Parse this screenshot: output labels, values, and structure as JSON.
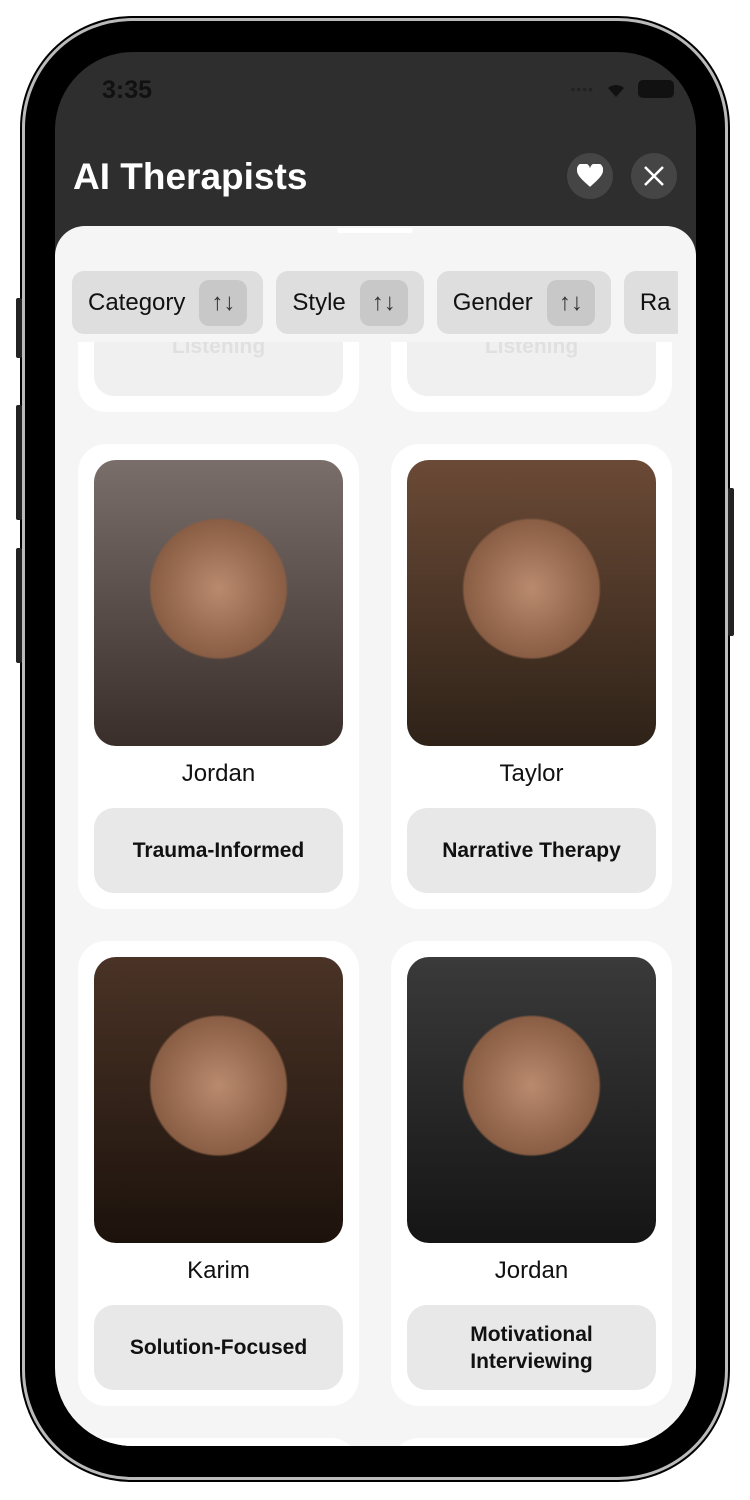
{
  "status_bar": {
    "time": "3:35"
  },
  "header": {
    "title": "AI Therapists",
    "favorites_icon": "heart-icon",
    "close_icon": "close-icon"
  },
  "filters": [
    {
      "label": "Category"
    },
    {
      "label": "Style"
    },
    {
      "label": "Gender"
    },
    {
      "label": "Ra"
    }
  ],
  "faded_row": {
    "left_tag": "Listening",
    "right_tag": "Listening"
  },
  "therapists": [
    {
      "name": "Jordan",
      "specialty": "Trauma-Informed",
      "photo_colors": [
        "#7a6e6a",
        "#3a2e2a"
      ]
    },
    {
      "name": "Taylor",
      "specialty": "Narrative Therapy",
      "photo_colors": [
        "#6b4a36",
        "#2e2218"
      ]
    },
    {
      "name": "Karim",
      "specialty": "Solution-Focused",
      "photo_colors": [
        "#4a3326",
        "#1c120c"
      ]
    },
    {
      "name": "Jordan",
      "specialty": "Motivational Interviewing",
      "photo_colors": [
        "#3a3a3a",
        "#151515"
      ]
    }
  ]
}
